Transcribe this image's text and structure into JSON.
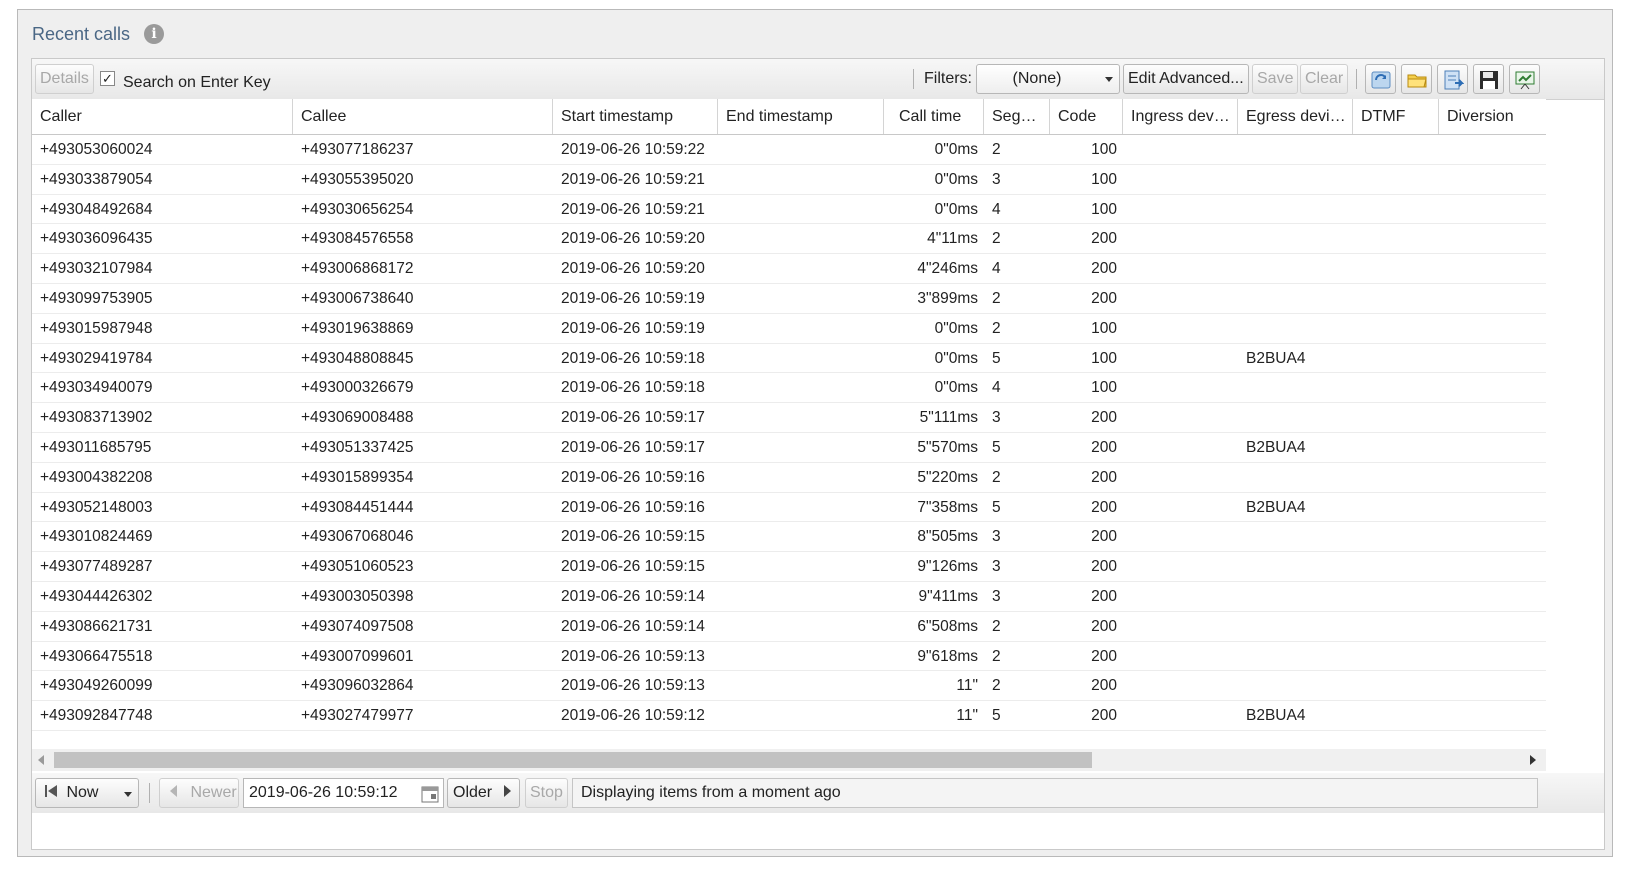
{
  "panel": {
    "title": "Recent calls",
    "info_icon": "info-icon"
  },
  "toolbar": {
    "details_label": "Details",
    "search_on_enter_checked": true,
    "search_on_enter_label": "Search on Enter Key",
    "filters_label": "Filters:",
    "filter_value": "(None)",
    "edit_advanced_label": "Edit Advanced...",
    "save_label": "Save",
    "clear_label": "Clear",
    "icons": [
      "refresh-icon",
      "open-folder-icon",
      "export-icon",
      "save-disk-icon",
      "presentation-icon"
    ]
  },
  "columns": [
    "Caller",
    "Callee",
    "Start timestamp",
    "End timestamp",
    "Call time",
    "Seg…",
    "Code",
    "Ingress dev…",
    "Egress devi…",
    "DTMF",
    "Diversion"
  ],
  "rows": [
    {
      "caller": "+493053060024",
      "callee": "+493077186237",
      "start": "2019-06-26 10:59:22",
      "end": "",
      "call_time": "0\"0ms",
      "seg": "2",
      "code": "100",
      "ingress": "",
      "egress": "",
      "dtmf": "",
      "diversion": ""
    },
    {
      "caller": "+493033879054",
      "callee": "+493055395020",
      "start": "2019-06-26 10:59:21",
      "end": "",
      "call_time": "0\"0ms",
      "seg": "3",
      "code": "100",
      "ingress": "",
      "egress": "",
      "dtmf": "",
      "diversion": ""
    },
    {
      "caller": "+493048492684",
      "callee": "+493030656254",
      "start": "2019-06-26 10:59:21",
      "end": "",
      "call_time": "0\"0ms",
      "seg": "4",
      "code": "100",
      "ingress": "",
      "egress": "",
      "dtmf": "",
      "diversion": ""
    },
    {
      "caller": "+493036096435",
      "callee": "+493084576558",
      "start": "2019-06-26 10:59:20",
      "end": "",
      "call_time": "4\"11ms",
      "seg": "2",
      "code": "200",
      "ingress": "",
      "egress": "",
      "dtmf": "",
      "diversion": ""
    },
    {
      "caller": "+493032107984",
      "callee": "+493006868172",
      "start": "2019-06-26 10:59:20",
      "end": "",
      "call_time": "4\"246ms",
      "seg": "4",
      "code": "200",
      "ingress": "",
      "egress": "",
      "dtmf": "",
      "diversion": ""
    },
    {
      "caller": "+493099753905",
      "callee": "+493006738640",
      "start": "2019-06-26 10:59:19",
      "end": "",
      "call_time": "3\"899ms",
      "seg": "2",
      "code": "200",
      "ingress": "",
      "egress": "",
      "dtmf": "",
      "diversion": ""
    },
    {
      "caller": "+493015987948",
      "callee": "+493019638869",
      "start": "2019-06-26 10:59:19",
      "end": "",
      "call_time": "0\"0ms",
      "seg": "2",
      "code": "100",
      "ingress": "",
      "egress": "",
      "dtmf": "",
      "diversion": ""
    },
    {
      "caller": "+493029419784",
      "callee": "+493048808845",
      "start": "2019-06-26 10:59:18",
      "end": "",
      "call_time": "0\"0ms",
      "seg": "5",
      "code": "100",
      "ingress": "",
      "egress": "B2BUA4",
      "dtmf": "",
      "diversion": ""
    },
    {
      "caller": "+493034940079",
      "callee": "+493000326679",
      "start": "2019-06-26 10:59:18",
      "end": "",
      "call_time": "0\"0ms",
      "seg": "4",
      "code": "100",
      "ingress": "",
      "egress": "",
      "dtmf": "",
      "diversion": ""
    },
    {
      "caller": "+493083713902",
      "callee": "+493069008488",
      "start": "2019-06-26 10:59:17",
      "end": "",
      "call_time": "5\"111ms",
      "seg": "3",
      "code": "200",
      "ingress": "",
      "egress": "",
      "dtmf": "",
      "diversion": ""
    },
    {
      "caller": "+493011685795",
      "callee": "+493051337425",
      "start": "2019-06-26 10:59:17",
      "end": "",
      "call_time": "5\"570ms",
      "seg": "5",
      "code": "200",
      "ingress": "",
      "egress": "B2BUA4",
      "dtmf": "",
      "diversion": ""
    },
    {
      "caller": "+493004382208",
      "callee": "+493015899354",
      "start": "2019-06-26 10:59:16",
      "end": "",
      "call_time": "5\"220ms",
      "seg": "2",
      "code": "200",
      "ingress": "",
      "egress": "",
      "dtmf": "",
      "diversion": ""
    },
    {
      "caller": "+493052148003",
      "callee": "+493084451444",
      "start": "2019-06-26 10:59:16",
      "end": "",
      "call_time": "7\"358ms",
      "seg": "5",
      "code": "200",
      "ingress": "",
      "egress": "B2BUA4",
      "dtmf": "",
      "diversion": ""
    },
    {
      "caller": "+493010824469",
      "callee": "+493067068046",
      "start": "2019-06-26 10:59:15",
      "end": "",
      "call_time": "8\"505ms",
      "seg": "3",
      "code": "200",
      "ingress": "",
      "egress": "",
      "dtmf": "",
      "diversion": ""
    },
    {
      "caller": "+493077489287",
      "callee": "+493051060523",
      "start": "2019-06-26 10:59:15",
      "end": "",
      "call_time": "9\"126ms",
      "seg": "3",
      "code": "200",
      "ingress": "",
      "egress": "",
      "dtmf": "",
      "diversion": ""
    },
    {
      "caller": "+493044426302",
      "callee": "+493003050398",
      "start": "2019-06-26 10:59:14",
      "end": "",
      "call_time": "9\"411ms",
      "seg": "3",
      "code": "200",
      "ingress": "",
      "egress": "",
      "dtmf": "",
      "diversion": ""
    },
    {
      "caller": "+493086621731",
      "callee": "+493074097508",
      "start": "2019-06-26 10:59:14",
      "end": "",
      "call_time": "6\"508ms",
      "seg": "2",
      "code": "200",
      "ingress": "",
      "egress": "",
      "dtmf": "",
      "diversion": ""
    },
    {
      "caller": "+493066475518",
      "callee": "+493007099601",
      "start": "2019-06-26 10:59:13",
      "end": "",
      "call_time": "9\"618ms",
      "seg": "2",
      "code": "200",
      "ingress": "",
      "egress": "",
      "dtmf": "",
      "diversion": ""
    },
    {
      "caller": "+493049260099",
      "callee": "+493096032864",
      "start": "2019-06-26 10:59:13",
      "end": "",
      "call_time": "11\"",
      "seg": "2",
      "code": "200",
      "ingress": "",
      "egress": "",
      "dtmf": "",
      "diversion": ""
    },
    {
      "caller": "+493092847748",
      "callee": "+493027479977",
      "start": "2019-06-26 10:59:12",
      "end": "",
      "call_time": "11\"",
      "seg": "5",
      "code": "200",
      "ingress": "",
      "egress": "B2BUA4",
      "dtmf": "",
      "diversion": ""
    }
  ],
  "pager": {
    "now_label": "Now",
    "newer_label": "Newer",
    "date_value": "2019-06-26 10:59:12",
    "older_label": "Older",
    "stop_label": "Stop",
    "status_text": "Displaying items from a moment ago"
  }
}
